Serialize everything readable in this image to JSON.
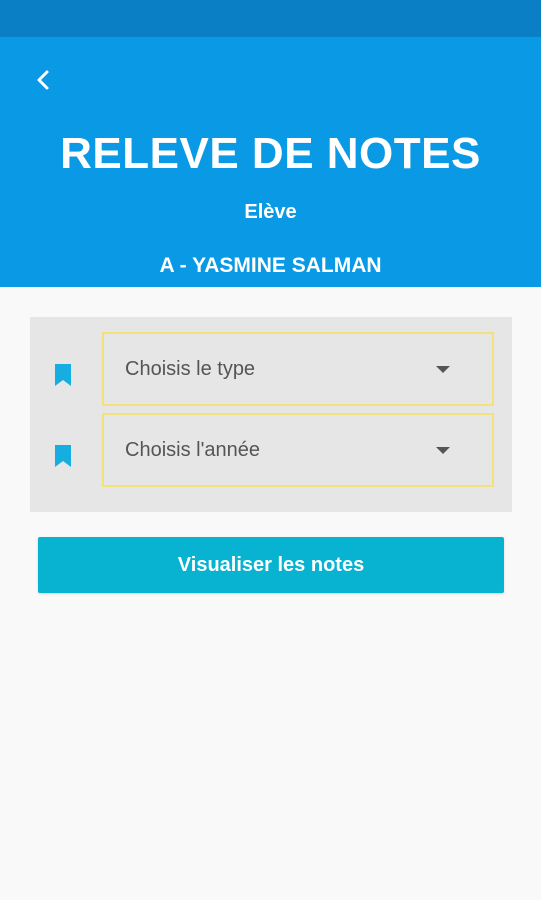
{
  "header": {
    "title": "RELEVE DE NOTES",
    "role": "Elève",
    "student_name": "A - YASMINE SALMAN"
  },
  "form": {
    "type_select": {
      "label": "Choisis le type",
      "icon": "bookmark-icon"
    },
    "year_select": {
      "label": "Choisis l'année",
      "icon": "bookmark-icon"
    }
  },
  "actions": {
    "view_grades_label": "Visualiser les notes"
  },
  "colors": {
    "header_bg": "#0a99e4",
    "status_bar": "#0a7fc6",
    "accent_button": "#08b3d1",
    "icon": "#16aee0",
    "select_border": "#f3e27a"
  }
}
